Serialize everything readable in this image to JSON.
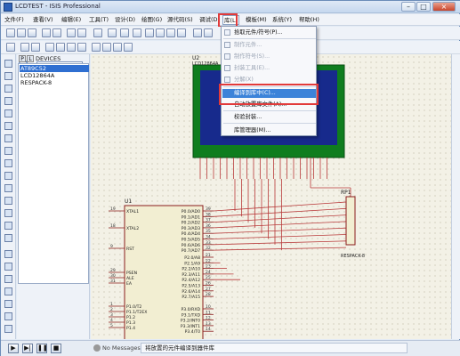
{
  "window": {
    "title": "LCDTEST - ISIS Professional"
  },
  "menus": [
    "文件(F)",
    "查看(V)",
    "编辑(E)",
    "工具(T)",
    "设计(D)",
    "绘图(G)",
    "源代码(S)",
    "调试(D)",
    "库(L)",
    "模板(M)",
    "系统(Y)",
    "帮助(H)"
  ],
  "library_menu": {
    "items": [
      {
        "label": "拾取元件/符号(P)...",
        "shortcut": "P",
        "enabled": true
      },
      {
        "label": "制作元件...",
        "enabled": false
      },
      {
        "label": "制作符号(S)...",
        "enabled": false
      },
      {
        "label": "封装工具(E)...",
        "enabled": false
      },
      {
        "label": "分解(X)",
        "enabled": false
      },
      {
        "label": "编译到库中(C)...",
        "enabled": true,
        "highlighted": true
      },
      {
        "label": "自动放置库文件(A)...",
        "enabled": true
      },
      {
        "label": "校验封装...",
        "enabled": true
      },
      {
        "label": "库管理器(M)...",
        "enabled": true
      }
    ]
  },
  "device_panel": {
    "angle": "0",
    "p_button": "P",
    "l_button": "L",
    "header": "DEVICES",
    "devices": [
      "AT89C52",
      "LCD12864A",
      "RESPACK-8"
    ],
    "selected": "AT89C52"
  },
  "schematic": {
    "u2": {
      "ref": "U2",
      "part": "LCD12864A",
      "screen_color": "#172a8c",
      "bezel_color": "#0f7d1e"
    },
    "u1": {
      "ref": "U1",
      "left_pins": [
        [
          "19",
          "XTAL1"
        ],
        [
          "18",
          "XTAL2"
        ],
        [
          "9",
          "RST"
        ],
        [
          "29",
          "PSEN"
        ],
        [
          "30",
          "ALE"
        ],
        [
          "31",
          "EA"
        ],
        [
          "1",
          "P1.0/T2"
        ],
        [
          "2",
          "P1.1/T2EX"
        ],
        [
          "3",
          "P1.2"
        ],
        [
          "4",
          "P1.3"
        ],
        [
          "5",
          "P1.4"
        ]
      ],
      "p0": [
        "P0.0/AD0",
        "P0.1/AD1",
        "P0.2/AD2",
        "P0.3/AD3",
        "P0.4/AD4",
        "P0.5/AD5",
        "P0.6/AD6",
        "P0.7/AD7"
      ],
      "p0_nums": [
        "39",
        "38",
        "37",
        "36",
        "35",
        "34",
        "33",
        "32"
      ],
      "p2": [
        "P2.0/A8",
        "P2.1/A9",
        "P2.2/A10",
        "P2.3/A11",
        "P2.4/A12",
        "P2.5/A13",
        "P2.6/A14",
        "P2.7/A15"
      ],
      "p2_nums": [
        "21",
        "22",
        "23",
        "24",
        "25",
        "26",
        "27",
        "28"
      ],
      "p3": [
        "P3.0/RXD",
        "P3.1/TXD",
        "P3.2/INT0",
        "P3.3/INT1",
        "P3.4/T0"
      ],
      "p3_nums": [
        "10",
        "11",
        "12",
        "13",
        "14"
      ]
    },
    "rp1": {
      "ref": "RP1",
      "part": "RESPACK-8"
    }
  },
  "status": {
    "messages": "No Messages",
    "text": "将放置的元件编译到器件库"
  },
  "colors": {
    "wire": "#b83a3a",
    "component_fill": "#f2eed2",
    "component_border": "#8a1c1c",
    "highlight_red": "#e23a3a",
    "menu_highlight": "#3c83d9"
  }
}
